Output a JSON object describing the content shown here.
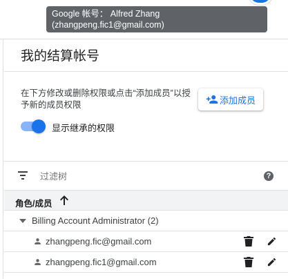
{
  "tooltip": {
    "line1": "Google 帐号： Alfred Zhang",
    "line2": "(zhangpeng.fic1@gmail.com)"
  },
  "page": {
    "title": "我的结算帐号",
    "description": "在下方修改或删除权限或点击“添加成员”以授予新的成员权限",
    "add_member_label": "添加成员",
    "inherited_toggle_label": "显示继承的权限",
    "inherited_toggle_on": true
  },
  "filter": {
    "placeholder": "过滤树"
  },
  "table": {
    "column_header": "角色/成员",
    "sort": "ascending",
    "groups": [
      {
        "label": "Billing Account Administrator (2)",
        "expanded": true,
        "members": [
          {
            "email": "zhangpeng.fic@gmail.com"
          },
          {
            "email": "zhangpeng.fic1@gmail.com"
          }
        ]
      }
    ]
  },
  "colors": {
    "accent": "#1a73e8",
    "toggle_track": "#8ab4f8",
    "icon_gray": "#5f6368",
    "tooltip_bg": "#5f6368"
  }
}
